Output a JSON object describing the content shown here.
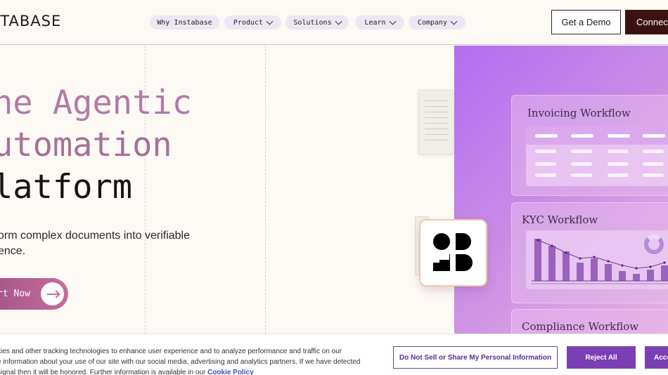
{
  "header": {
    "logo": "STABASE",
    "nav": [
      {
        "label": "Why Instabase",
        "has_dropdown": false
      },
      {
        "label": "Product",
        "has_dropdown": true
      },
      {
        "label": "Solutions",
        "has_dropdown": true
      },
      {
        "label": "Learn",
        "has_dropdown": true
      },
      {
        "label": "Company",
        "has_dropdown": true
      }
    ],
    "demo_button": "Get a Demo",
    "connect_button": "Connect"
  },
  "hero": {
    "title_line1": "he Agentic",
    "title_line2": "utomation",
    "title_line3": "latform",
    "subtitle_line1": "orm complex documents into verifiable",
    "subtitle_line2": "ence.",
    "cta_label": "rt Now"
  },
  "workflows": {
    "invoicing": "Invoicing Workflow",
    "kyc": "KYC Workflow",
    "compliance": "Compliance Workflow"
  },
  "cookie_banner": {
    "line1": "kies and other tracking technologies to enhance user experience and to analyze performance and traffic on our",
    "line2": "e information about your use of our site with our social media, advertising and analytics partners. If we have detected",
    "line3": "signal then it will be honored. Further information is available in our",
    "policy_link": "Cookie Policy",
    "do_not_sell_button": "Do Not Sell or Share My Personal Information",
    "reject_button": "Reject All",
    "accept_button": "Accept"
  },
  "colors": {
    "accent": "#7b3fb4",
    "connect_bg": "#3a1210",
    "hero_gradient_text": "#b27aa8",
    "panel_purple": "#b36ef0"
  }
}
